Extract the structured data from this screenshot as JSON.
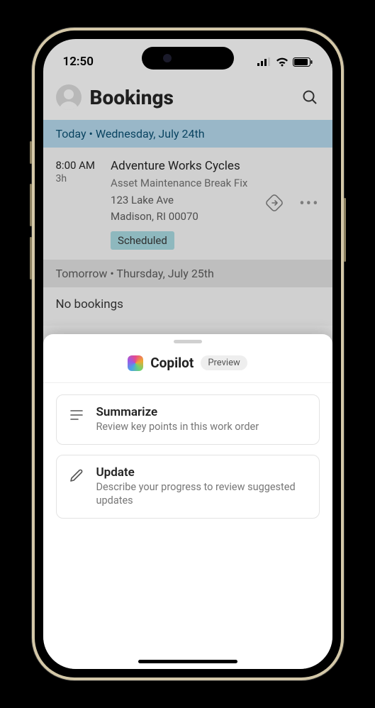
{
  "statusBar": {
    "time": "12:50"
  },
  "header": {
    "title": "Bookings"
  },
  "sections": {
    "today": {
      "label": "Today • Wednesday, July 24th",
      "booking": {
        "time": "8:00 AM",
        "duration": "3h",
        "title": "Adventure Works Cycles",
        "subtitle": "Asset Maintenance Break Fix",
        "addressLine1": "123 Lake Ave",
        "addressLine2": "Madison, RI 00070",
        "status": "Scheduled"
      }
    },
    "tomorrow": {
      "label": "Tomorrow • Thursday, July 25th",
      "empty": "No bookings"
    }
  },
  "copilot": {
    "title": "Copilot",
    "badge": "Preview",
    "actions": [
      {
        "title": "Summarize",
        "desc": "Review key points in this work order"
      },
      {
        "title": "Update",
        "desc": "Describe your progress to review suggested updates"
      }
    ]
  }
}
